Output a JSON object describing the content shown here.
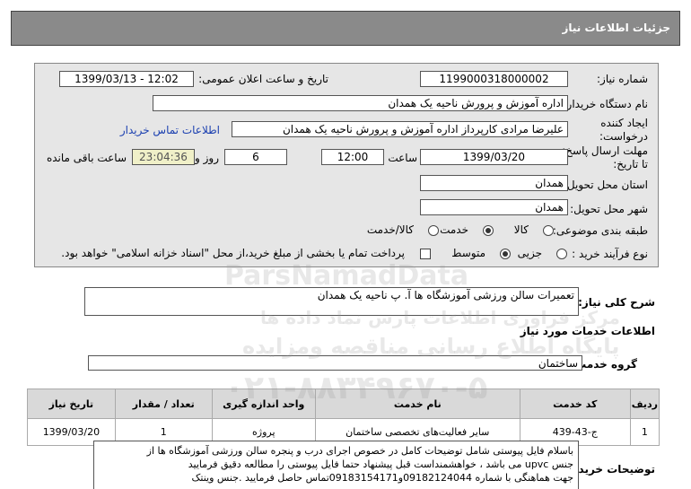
{
  "header": {
    "title": "جزئیات اطلاعات نیاز"
  },
  "form": {
    "need_number_label": "شماره نیاز:",
    "need_number": "1199000318000002",
    "announce_label": "تاریخ و ساعت اعلان عمومی:",
    "announce_value": "1399/03/13 - 12:02",
    "buyer_label": "نام دستگاه خریدار:",
    "buyer_value": "اداره آموزش و پرورش ناحیه یک همدان",
    "creator_label_1": "ایجاد کننده",
    "creator_label_2": "درخواست:",
    "creator_value": "علیرضا مرادی کارپرداز اداره آموزش و پرورش ناحیه یک همدان",
    "contact_link": "اطلاعات تماس خریدار",
    "deadline_label_1": "مهلت ارسال پاسخ:",
    "deadline_label_2": "تا تاریخ:",
    "deadline_date": "1399/03/20",
    "time_label": "ساعت",
    "deadline_time": "12:00",
    "days_value": "6",
    "days_label": "روز و",
    "remaining_time": "23:04:36",
    "remaining_label": "ساعت باقی مانده",
    "province_label": "استان محل تحویل:",
    "province_value": "همدان",
    "city_label": "شهر محل تحویل:",
    "city_value": "همدان",
    "category_label": "طبقه بندی موضوعی:",
    "category_options": [
      "کالا",
      "خدمت",
      "کالا/خدمت"
    ],
    "category_selected": "خدمت",
    "process_label": "نوع فرآیند خرید :",
    "process_options": [
      "جزیی",
      "متوسط"
    ],
    "process_selected": "متوسط",
    "payment_note": "پرداخت تمام یا بخشی از مبلغ خرید،از محل \"اسناد خزانه اسلامی\" خواهد بود."
  },
  "summary": {
    "label": "شرح کلی نیاز:",
    "value": "تعمیرات سالن ورزشی آموزشگاه ها آ. پ ناحیه یک همدان"
  },
  "services": {
    "section_title": "اطلاعات خدمات مورد نیاز",
    "group_label": "گروه خدمت:",
    "group_value": "ساختمان",
    "columns": [
      "ردیف",
      "کد خدمت",
      "نام خدمت",
      "واحد اندازه گیری",
      "تعداد / مقدار",
      "تاریخ نیاز"
    ],
    "rows": [
      [
        "1",
        "ج-43-439",
        "سایر فعالیت‌های تخصصی ساختمان",
        "پروژه",
        "1",
        "1399/03/20"
      ]
    ]
  },
  "buyer_notes": {
    "label": "توضیحات خریدار:",
    "lines": [
      "باسلام فایل پیوستی شامل توضیحات کامل در خصوص اجرای درب و پنجره سالن ورزشی آموزشگاه ها از",
      "جنس upvc     می باشد ، خواهشمنداست قبل پیشنهاد حتما فایل پیوستی را مطالعه دقیق فرمایید",
      "جهت هماهنگی با شماره 09182124044و09183154171تماس حاصل فرمایید .جنس وینتک"
    ]
  },
  "watermark": {
    "brand": "ParsNamadData",
    "line1": "مرکز فراوری اطلاعات پارس نماد داده ها",
    "line2": "پایگاه اطلاع رسانی مناقصه ومزایده",
    "phone": "۰۲۱-۸۸۳۴۹۶۷۰-۵"
  }
}
